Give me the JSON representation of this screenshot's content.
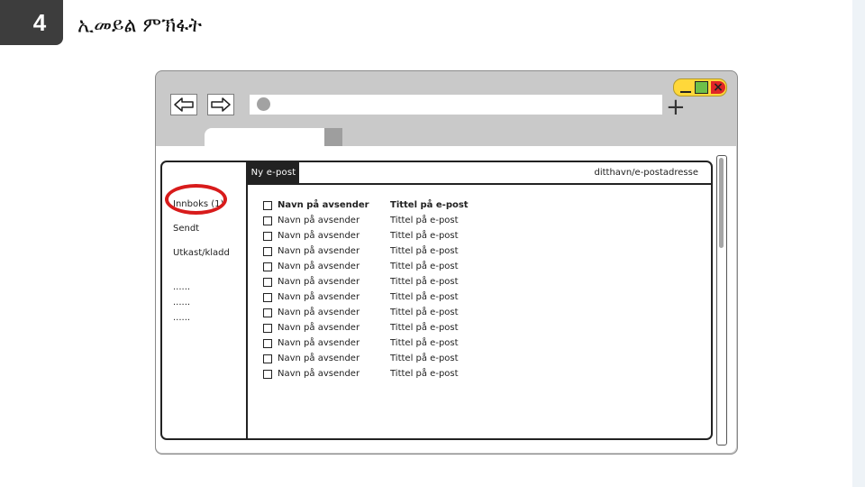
{
  "slide": {
    "number": "4",
    "title": "ኢመይል ምኽፋት"
  },
  "browser": {
    "new_tab_symbol": "+",
    "window_close_symbol": "×"
  },
  "mail": {
    "compose_label": "Ny e-post",
    "user_address": "ditthavn/e-postadresse",
    "folders": [
      {
        "label": "Innboks (1)",
        "highlighted": true
      },
      {
        "label": "Sendt"
      },
      {
        "label": "Utkast/kladd"
      }
    ],
    "more": [
      "......",
      "......",
      "......"
    ],
    "messages": [
      {
        "sender": "Navn på avsender",
        "subject": "Tittel på e-post",
        "unread": true
      },
      {
        "sender": "Navn på avsender",
        "subject": "Tittel på e-post"
      },
      {
        "sender": "Navn på avsender",
        "subject": "Tittel på e-post"
      },
      {
        "sender": "Navn på avsender",
        "subject": "Tittel på e-post"
      },
      {
        "sender": "Navn på avsender",
        "subject": "Tittel på e-post"
      },
      {
        "sender": "Navn på avsender",
        "subject": "Tittel på e-post"
      },
      {
        "sender": "Navn på avsender",
        "subject": "Tittel på e-post"
      },
      {
        "sender": "Navn på avsender",
        "subject": "Tittel på e-post"
      },
      {
        "sender": "Navn på avsender",
        "subject": "Tittel på e-post"
      },
      {
        "sender": "Navn på avsender",
        "subject": "Tittel på e-post"
      },
      {
        "sender": "Navn på avsender",
        "subject": "Tittel på e-post"
      },
      {
        "sender": "Navn på avsender",
        "subject": "Tittel på e-post"
      }
    ]
  },
  "colors": {
    "highlight_ring": "#d81b1b",
    "window_controls": "#ffd83a",
    "maximize": "#6ec04a",
    "close": "#e02626"
  }
}
